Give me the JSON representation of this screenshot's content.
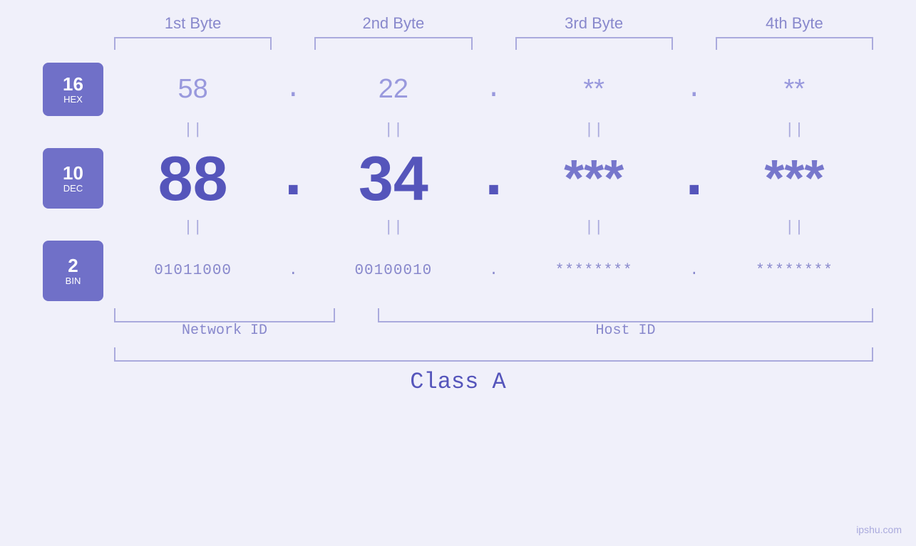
{
  "header": {
    "byte1": "1st Byte",
    "byte2": "2nd Byte",
    "byte3": "3rd Byte",
    "byte4": "4th Byte"
  },
  "badges": {
    "hex": {
      "number": "16",
      "label": "HEX"
    },
    "dec": {
      "number": "10",
      "label": "DEC"
    },
    "bin": {
      "number": "2",
      "label": "BIN"
    }
  },
  "hex_row": {
    "b1": "58",
    "b2": "22",
    "b3": "**",
    "b4": "**",
    "dots": [
      ".",
      ".",
      ".",
      "."
    ]
  },
  "dec_row": {
    "b1": "88",
    "b2": "34",
    "b3": "***",
    "b4": "***",
    "dots": [
      ".",
      ".",
      ".",
      "."
    ]
  },
  "bin_row": {
    "b1": "01011000",
    "b2": "00100010",
    "b3": "********",
    "b4": "********",
    "dots": [
      ".",
      ".",
      ".",
      "."
    ]
  },
  "labels": {
    "network_id": "Network ID",
    "host_id": "Host ID",
    "class": "Class A"
  },
  "footer": {
    "text": "ipshu.com"
  },
  "equals_sign": "||"
}
